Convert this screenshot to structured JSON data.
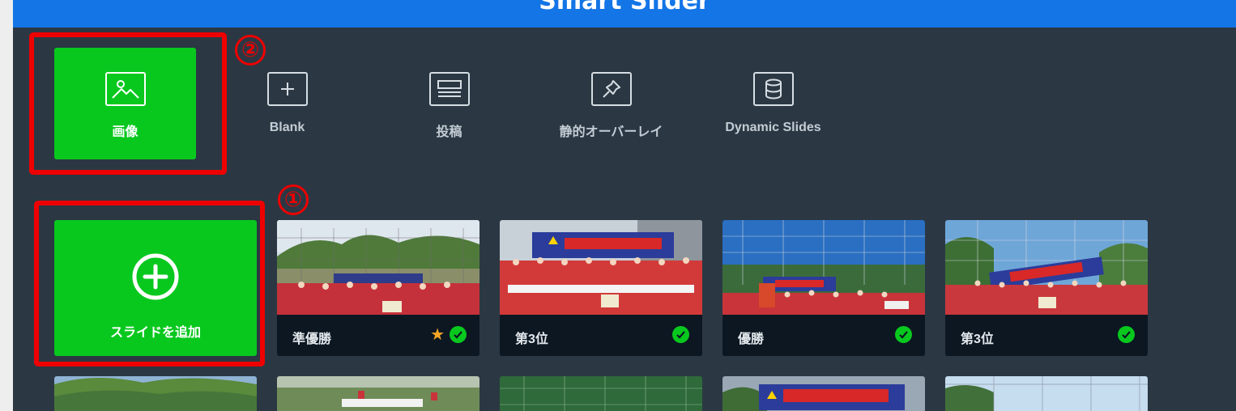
{
  "header": {
    "title": "Smart Slider"
  },
  "slide_types": [
    {
      "label": "画像",
      "icon": "image-icon",
      "active": true
    },
    {
      "label": "Blank",
      "icon": "plus-icon",
      "active": false
    },
    {
      "label": "投稿",
      "icon": "post-icon",
      "active": false
    },
    {
      "label": "静的オーバーレイ",
      "icon": "pin-icon",
      "active": false
    },
    {
      "label": "Dynamic Slides",
      "icon": "database-icon",
      "active": false
    }
  ],
  "add_slide": {
    "label": "スライドを追加",
    "icon": "plus-circle-icon"
  },
  "slides": [
    {
      "title": "準優勝",
      "starred": true,
      "published": true
    },
    {
      "title": "第3位",
      "starred": false,
      "published": true
    },
    {
      "title": "優勝",
      "starred": false,
      "published": true
    },
    {
      "title": "第3位",
      "starred": false,
      "published": true
    }
  ],
  "annotations": [
    {
      "number": "①"
    },
    {
      "number": "②"
    }
  ],
  "colors": {
    "header_blue": "#1375e6",
    "panel_bg": "#2b3844",
    "accent_green": "#08c81e",
    "annotation_red": "#ee0000",
    "star": "#f5a623"
  }
}
